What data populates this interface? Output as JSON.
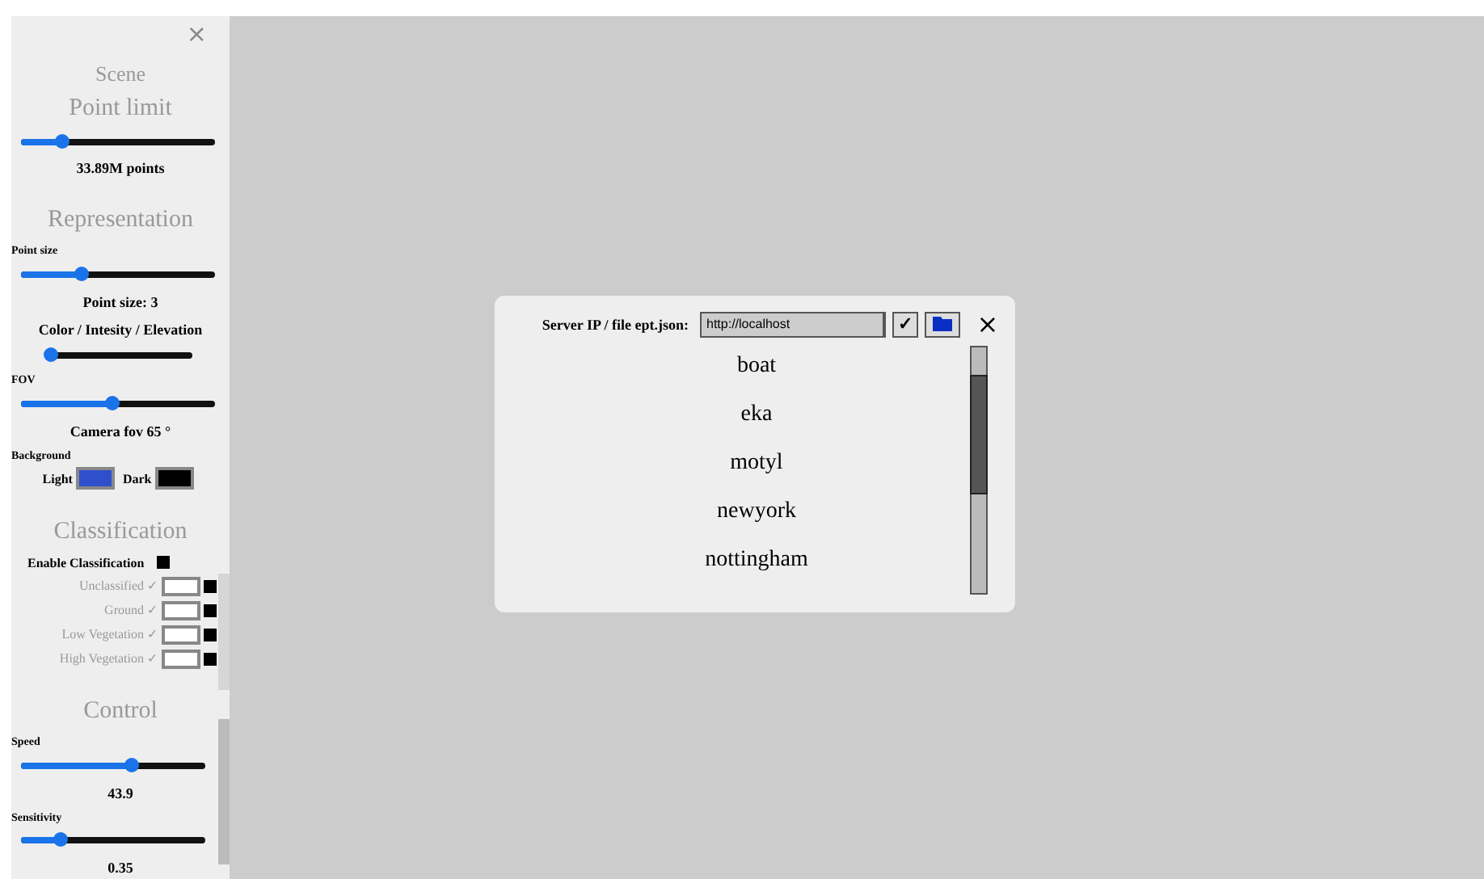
{
  "sidebar": {
    "close": "×",
    "items": [
      {
        "kind": "heading",
        "text": "Scene"
      },
      {
        "kind": "section",
        "text": "Point limit"
      },
      {
        "kind": "slider",
        "level": 0.21
      },
      {
        "kind": "caption",
        "text": "33.89M points"
      },
      {
        "kind": "section",
        "text": "Representation"
      },
      {
        "kind": "label",
        "text": "Point size"
      },
      {
        "kind": "slider",
        "level": 0.31
      },
      {
        "kind": "caption",
        "text": "Point size: 3"
      },
      {
        "kind": "caption",
        "text": "Color / Intesity / Elevation"
      },
      {
        "kind": "short-slider",
        "level": 0.0
      },
      {
        "kind": "label",
        "text": "FOV"
      },
      {
        "kind": "slider",
        "level": 0.47
      },
      {
        "kind": "caption",
        "text": "Camera fov 65 °"
      },
      {
        "kind": "label",
        "text": "Background"
      },
      {
        "kind": "swatches",
        "swatches": [
          {
            "label": "Light",
            "color": "#2f4fcc"
          },
          {
            "label": "Dark",
            "color": "#000000"
          }
        ]
      },
      {
        "kind": "section",
        "text": "Classification"
      },
      {
        "kind": "toggle",
        "text": "Enable Classification",
        "checked": true
      },
      {
        "kind": "class",
        "text": "Unclassified ✓",
        "color": "#ffffff",
        "checked": true
      },
      {
        "kind": "class",
        "text": "Ground ✓",
        "color": "#ffffff",
        "checked": true
      },
      {
        "kind": "class",
        "text": "Low Vegetation ✓",
        "color": "#ffffff",
        "checked": true
      },
      {
        "kind": "class",
        "text": "High Vegetation ✓",
        "color": "#ffffff",
        "checked": true
      },
      {
        "kind": "section",
        "text": "Control"
      },
      {
        "kind": "label",
        "text": "Speed"
      },
      {
        "kind": "mid-slider",
        "level": 0.6
      },
      {
        "kind": "caption",
        "text": "43.9"
      },
      {
        "kind": "label",
        "text": "Sensitivity"
      },
      {
        "kind": "mid-slider",
        "level": 0.21
      },
      {
        "kind": "caption",
        "text": "0.35"
      }
    ]
  },
  "dialog": {
    "label": "Server IP / file ept.json:",
    "value": "http://localhost",
    "confirm": "✓",
    "close": "×",
    "items": [
      "boat",
      "eka",
      "motyl",
      "newyork",
      "nottingham"
    ]
  }
}
